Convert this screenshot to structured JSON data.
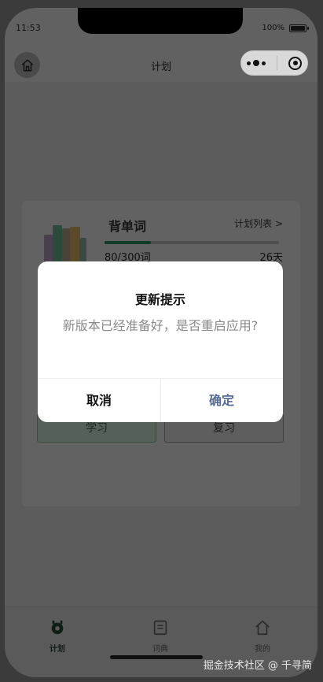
{
  "status_bar": {
    "time": "11:53",
    "battery": "100%"
  },
  "navbar": {
    "title": "计划"
  },
  "plan_card": {
    "book_title": "背单词",
    "plan_list_link": "计划列表 >",
    "progress_count": "80/300词",
    "progress_fraction": 0.267,
    "days": "26天",
    "study_button": "学习",
    "review_button": "复习"
  },
  "dialog": {
    "title": "更新提示",
    "message": "新版本已经准备好，是否重启应用?",
    "cancel": "取消",
    "confirm": "确定",
    "confirm_color": "#576b95"
  },
  "tabbar": {
    "items": [
      {
        "label": "计划",
        "icon": "plan-icon",
        "active": true
      },
      {
        "label": "词典",
        "icon": "dictionary-icon",
        "active": false
      },
      {
        "label": "我的",
        "icon": "profile-icon",
        "active": false
      }
    ]
  },
  "watermark": "掘金技术社区 @ 千寻简",
  "colors": {
    "accent": "#133a28",
    "overlay_dim": "#616161"
  }
}
